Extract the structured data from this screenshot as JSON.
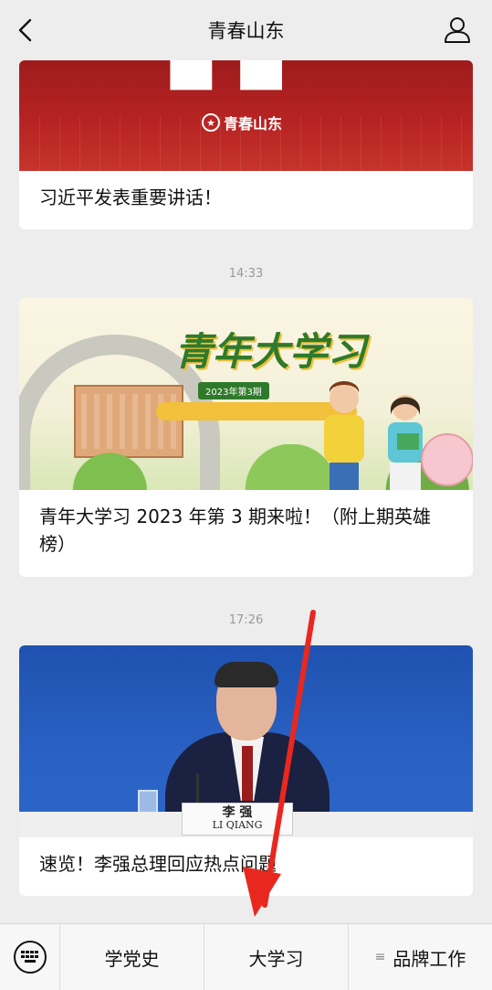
{
  "header": {
    "title": "青春山东"
  },
  "feed": {
    "article1": {
      "banner_logo": "青春山东",
      "caption": "习近平发表重要讲话！"
    },
    "time2": "14:33",
    "article2": {
      "headline": "青年大学习",
      "badge": "2023年第3期",
      "caption": "青年大学习 2023 年第 3 期来啦！（附上期英雄榜）"
    },
    "time3": "17:26",
    "article3": {
      "plate_cn": "李  强",
      "plate_en": "LI QIANG",
      "caption": "速览！李强总理回应热点问题"
    }
  },
  "menu": {
    "items": [
      "学党史",
      "大学习",
      "品牌工作"
    ]
  },
  "colors": {
    "annotation_arrow": "#e8281f"
  }
}
